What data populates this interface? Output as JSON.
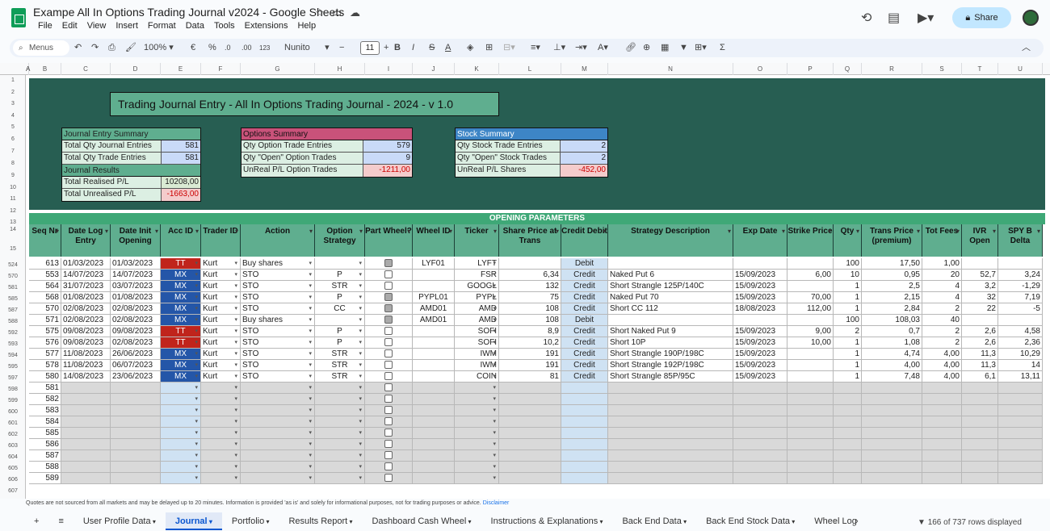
{
  "app": {
    "title": "Exampe All In Options Trading Journal v2024 - Google Sheets",
    "menu": [
      "File",
      "Edit",
      "View",
      "Insert",
      "Format",
      "Data",
      "Tools",
      "Extensions",
      "Help"
    ],
    "share_label": "Share"
  },
  "toolbar": {
    "menus_label": "Menus",
    "zoom": "100%",
    "currency": "€",
    "percent": "%",
    "dec_dec": ".0",
    "dec_inc": ".00",
    "format_123": "123",
    "font": "Nunito",
    "font_size": "11"
  },
  "columns": [
    "A",
    "B",
    "C",
    "D",
    "E",
    "F",
    "G",
    "H",
    "I",
    "J",
    "K",
    "L",
    "M",
    "N",
    "O",
    "P",
    "Q",
    "R",
    "S",
    "T",
    "U"
  ],
  "row_numbers_top": [
    "1",
    "2",
    "3",
    "4",
    "5",
    "6",
    "7",
    "8",
    "9",
    "10",
    "11",
    "12",
    "13",
    "14",
    "15"
  ],
  "row_numbers_data": [
    "524",
    "570",
    "581",
    "585",
    "587",
    "588",
    "592",
    "593",
    "594",
    "595",
    "597",
    "598",
    "599",
    "600",
    "601",
    "602",
    "603",
    "604",
    "605",
    "606",
    "607"
  ],
  "main_title": "Trading Journal Entry  - All In Options Trading Journal - 2024 - v 1.0",
  "journal_summary": {
    "header": "Journal Entry Summary",
    "rows": [
      {
        "label": "Total Qty Journal Entries",
        "value": "581"
      },
      {
        "label": "Total Qty Trade Entries",
        "value": "581"
      }
    ],
    "results_header": "Journal Results",
    "results": [
      {
        "label": "Total Realised P/L",
        "value": "10208,00"
      },
      {
        "label": "Total Unrealised P/L",
        "value": "-1663,00"
      }
    ]
  },
  "options_summary": {
    "header": "Options Summary",
    "rows": [
      {
        "label": "Qty Option Trade Entries",
        "value": "579"
      },
      {
        "label": "Qty \"Open\" Option Trades",
        "value": "9"
      },
      {
        "label": "UnReal P/L Option Trades",
        "value": "-1211,00"
      }
    ]
  },
  "stock_summary": {
    "header": "Stock Summary",
    "rows": [
      {
        "label": "Qty Stock Trade Entries",
        "value": "2"
      },
      {
        "label": "Qty \"Open\" Stock Trades",
        "value": "2"
      },
      {
        "label": "UnReal P/L Shares",
        "value": "-452,00"
      }
    ]
  },
  "section_header": "OPENING PARAMETERS",
  "table_headers": [
    "Seq Nr",
    "Date Log Entry",
    "Date Init Opening",
    "Acc ID",
    "Trader ID",
    "Action",
    "Option Strategy",
    "Part Wheel?",
    "Wheel ID",
    "Ticker",
    "Share Price at Trans",
    "Credit Debit",
    "Strategy Description",
    "Exp Date",
    "Strike Price",
    "Qty",
    "Trans Price (premium)",
    "Tot Fees",
    "IVR Open",
    "SPY B Delta"
  ],
  "rows": [
    [
      "613",
      "01/03/2023",
      "01/03/2023",
      "TT",
      "Kurt",
      "Buy shares",
      "",
      "on",
      "LYF01",
      "LYFT",
      "",
      "Debit",
      "",
      "",
      "",
      "100",
      "17,50",
      "1,00",
      "",
      ""
    ],
    [
      "553",
      "14/07/2023",
      "14/07/2023",
      "MX",
      "Kurt",
      "STO",
      "P",
      "off",
      "",
      "FSR",
      "6,34",
      "Credit",
      "Naked Put 6",
      "15/09/2023",
      "6,00",
      "10",
      "0,95",
      "20",
      "52,7",
      "3,24"
    ],
    [
      "564",
      "31/07/2023",
      "03/07/2023",
      "MX",
      "Kurt",
      "STO",
      "STR",
      "off",
      "",
      "GOOGL",
      "132",
      "Credit",
      "Short Strangle 125P/140C",
      "15/09/2023",
      "",
      "1",
      "2,5",
      "4",
      "3,2",
      "-1,29"
    ],
    [
      "568",
      "01/08/2023",
      "01/08/2023",
      "MX",
      "Kurt",
      "STO",
      "P",
      "on",
      "PYPL01",
      "PYPL",
      "75",
      "Credit",
      "Naked Put 70",
      "15/09/2023",
      "70,00",
      "1",
      "2,15",
      "4",
      "32",
      "7,19"
    ],
    [
      "570",
      "02/08/2023",
      "02/08/2023",
      "MX",
      "Kurt",
      "STO",
      "CC",
      "on",
      "AMD01",
      "AMD",
      "108",
      "Credit",
      "Short CC 112",
      "18/08/2023",
      "112,00",
      "1",
      "2,84",
      "2",
      "22",
      "-5"
    ],
    [
      "571",
      "02/08/2023",
      "02/08/2023",
      "MX",
      "Kurt",
      "Buy shares",
      "",
      "on",
      "AMD01",
      "AMD",
      "108",
      "Debit",
      "",
      "",
      "",
      "100",
      "108,03",
      "40",
      "",
      ""
    ],
    [
      "575",
      "09/08/2023",
      "09/08/2023",
      "TT",
      "Kurt",
      "STO",
      "P",
      "off",
      "",
      "SOFI",
      "8,9",
      "Credit",
      "Short Naked Put 9",
      "15/09/2023",
      "9,00",
      "2",
      "0,7",
      "2",
      "2,6",
      "4,58"
    ],
    [
      "576",
      "09/08/2023",
      "02/08/2023",
      "TT",
      "Kurt",
      "STO",
      "P",
      "off",
      "",
      "SOFI",
      "10,2",
      "Credit",
      "Short 10P",
      "15/09/2023",
      "10,00",
      "1",
      "1,08",
      "2",
      "2,6",
      "2,36"
    ],
    [
      "577",
      "11/08/2023",
      "26/06/2023",
      "MX",
      "Kurt",
      "STO",
      "STR",
      "off",
      "",
      "IWM",
      "191",
      "Credit",
      "Short Strangle 190P/198C",
      "15/09/2023",
      "",
      "1",
      "4,74",
      "4,00",
      "11,3",
      "10,29"
    ],
    [
      "578",
      "11/08/2023",
      "06/07/2023",
      "MX",
      "Kurt",
      "STO",
      "STR",
      "off",
      "",
      "IWM",
      "191",
      "Credit",
      "Short Strangle 192P/198C",
      "15/09/2023",
      "",
      "1",
      "4,00",
      "4,00",
      "11,3",
      "14"
    ],
    [
      "580",
      "14/08/2023",
      "23/06/2023",
      "MX",
      "Kurt",
      "STO",
      "STR",
      "off",
      "",
      "COIN",
      "81",
      "Credit",
      "Short Strangle 85P/95C",
      "15/09/2023",
      "",
      "1",
      "7,48",
      "4,00",
      "6,1",
      "13,11"
    ]
  ],
  "empty_seq": [
    "581",
    "582",
    "583",
    "584",
    "585",
    "586",
    "587",
    "588",
    "589"
  ],
  "colors": {
    "tt": "#c0241c",
    "mx": "#2456a8",
    "banner": "#275e52",
    "header": "#5fae8f"
  },
  "disclaimer": "Quotes are not sourced from all markets and may be delayed up to 20 minutes. Information is provided 'as is' and solely for informational purposes, not for trading purposes or advice.",
  "disclaimer_link": "Disclaimer",
  "sheet_tabs": [
    "User Profile Data",
    "Journal",
    "Portfolio",
    "Results Report",
    "Dashboard Cash Wheel",
    "Instructions & Explanations",
    "Back End Data",
    "Back End Stock Data",
    "Wheel Log"
  ],
  "active_tab": "Journal",
  "row_count": "166 of 737 rows displayed"
}
